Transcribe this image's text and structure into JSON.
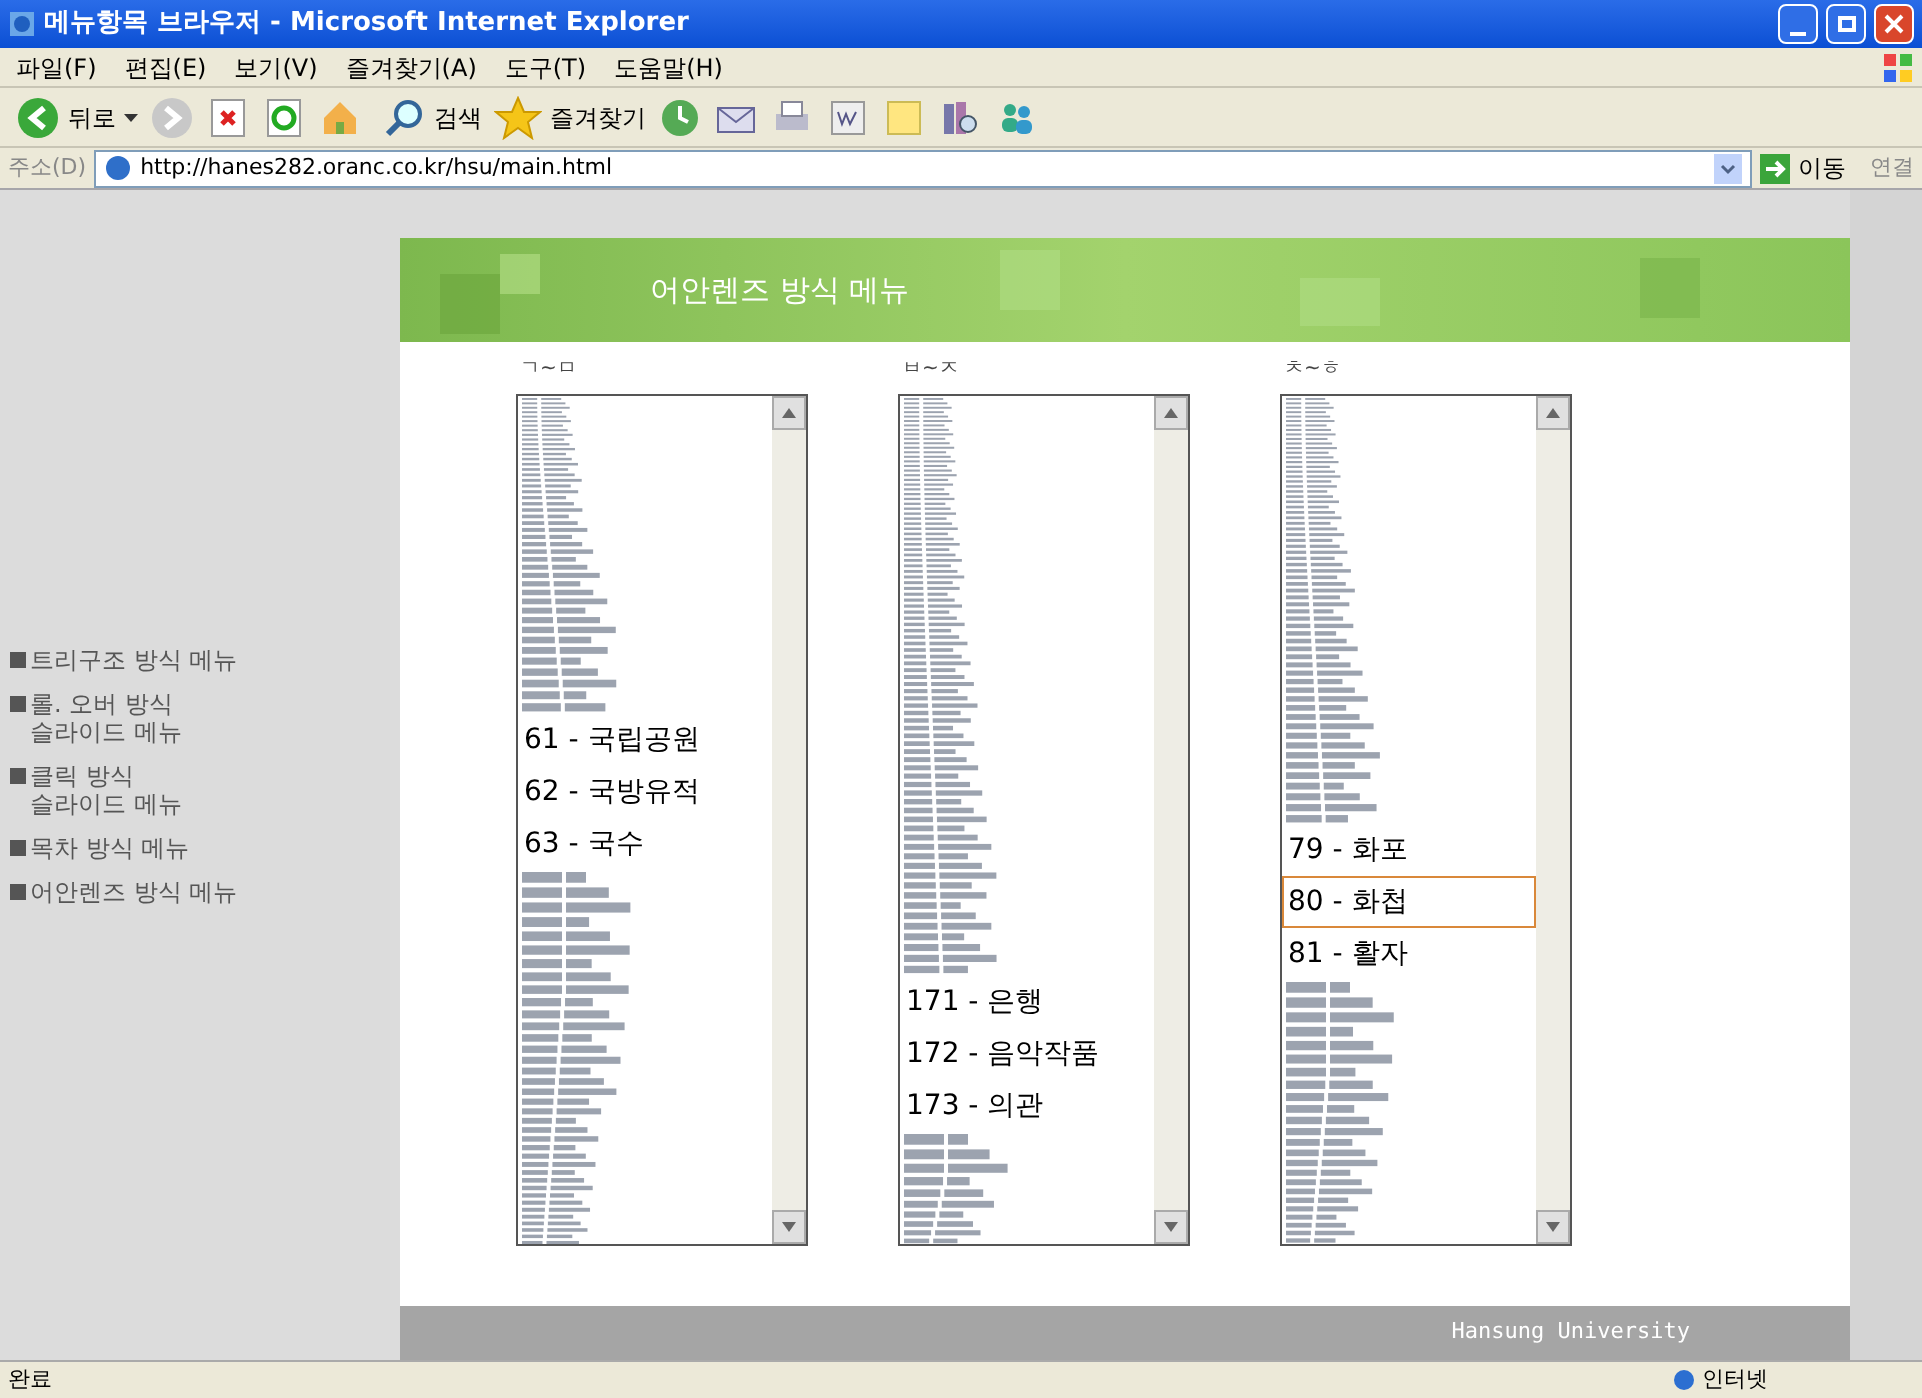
{
  "window": {
    "title": "메뉴항목 브라우저 - Microsoft Internet Explorer"
  },
  "menu_bar": [
    "파일(F)",
    "편집(E)",
    "보기(V)",
    "즐겨찾기(A)",
    "도구(T)",
    "도움말(H)"
  ],
  "toolbar": {
    "back": "뒤로",
    "search": "검색",
    "favorites": "즐겨찾기"
  },
  "address_bar": {
    "label": "주소(D)",
    "value": "http://hanes282.oranc.co.kr/hsu/main.html",
    "go": "이동",
    "links": "연결"
  },
  "sidebar": {
    "items": [
      {
        "label": "트리구조 방식 메뉴"
      },
      {
        "label": "롤. 오버 방식\n슬라이드 메뉴"
      },
      {
        "label": "클릭 방식\n슬라이드 메뉴"
      },
      {
        "label": "목차 방식 메뉴"
      },
      {
        "label": "어안렌즈 방식 메뉴"
      }
    ]
  },
  "header": {
    "title": "어안렌즈 방식 메뉴"
  },
  "lists": [
    {
      "heading": "ㄱ~ㅁ",
      "items": [
        {
          "label": "61 - 국립공원",
          "selected": false
        },
        {
          "label": "62 - 국방유적",
          "selected": false
        },
        {
          "label": "63 - 국수",
          "selected": false
        }
      ]
    },
    {
      "heading": "ㅂ~ㅈ",
      "items": [
        {
          "label": "171 - 은행",
          "selected": false
        },
        {
          "label": "172 - 음악작품",
          "selected": false
        },
        {
          "label": "173 - 의관",
          "selected": false
        }
      ]
    },
    {
      "heading": "ㅊ~ㅎ",
      "items": [
        {
          "label": "79 - 화포",
          "selected": false
        },
        {
          "label": "80 - 화첩",
          "selected": true
        },
        {
          "label": "81 - 활자",
          "selected": false
        }
      ]
    }
  ],
  "footer": {
    "text": "Hansung University"
  },
  "status_bar": {
    "text": "완료",
    "zone": "인터넷"
  }
}
